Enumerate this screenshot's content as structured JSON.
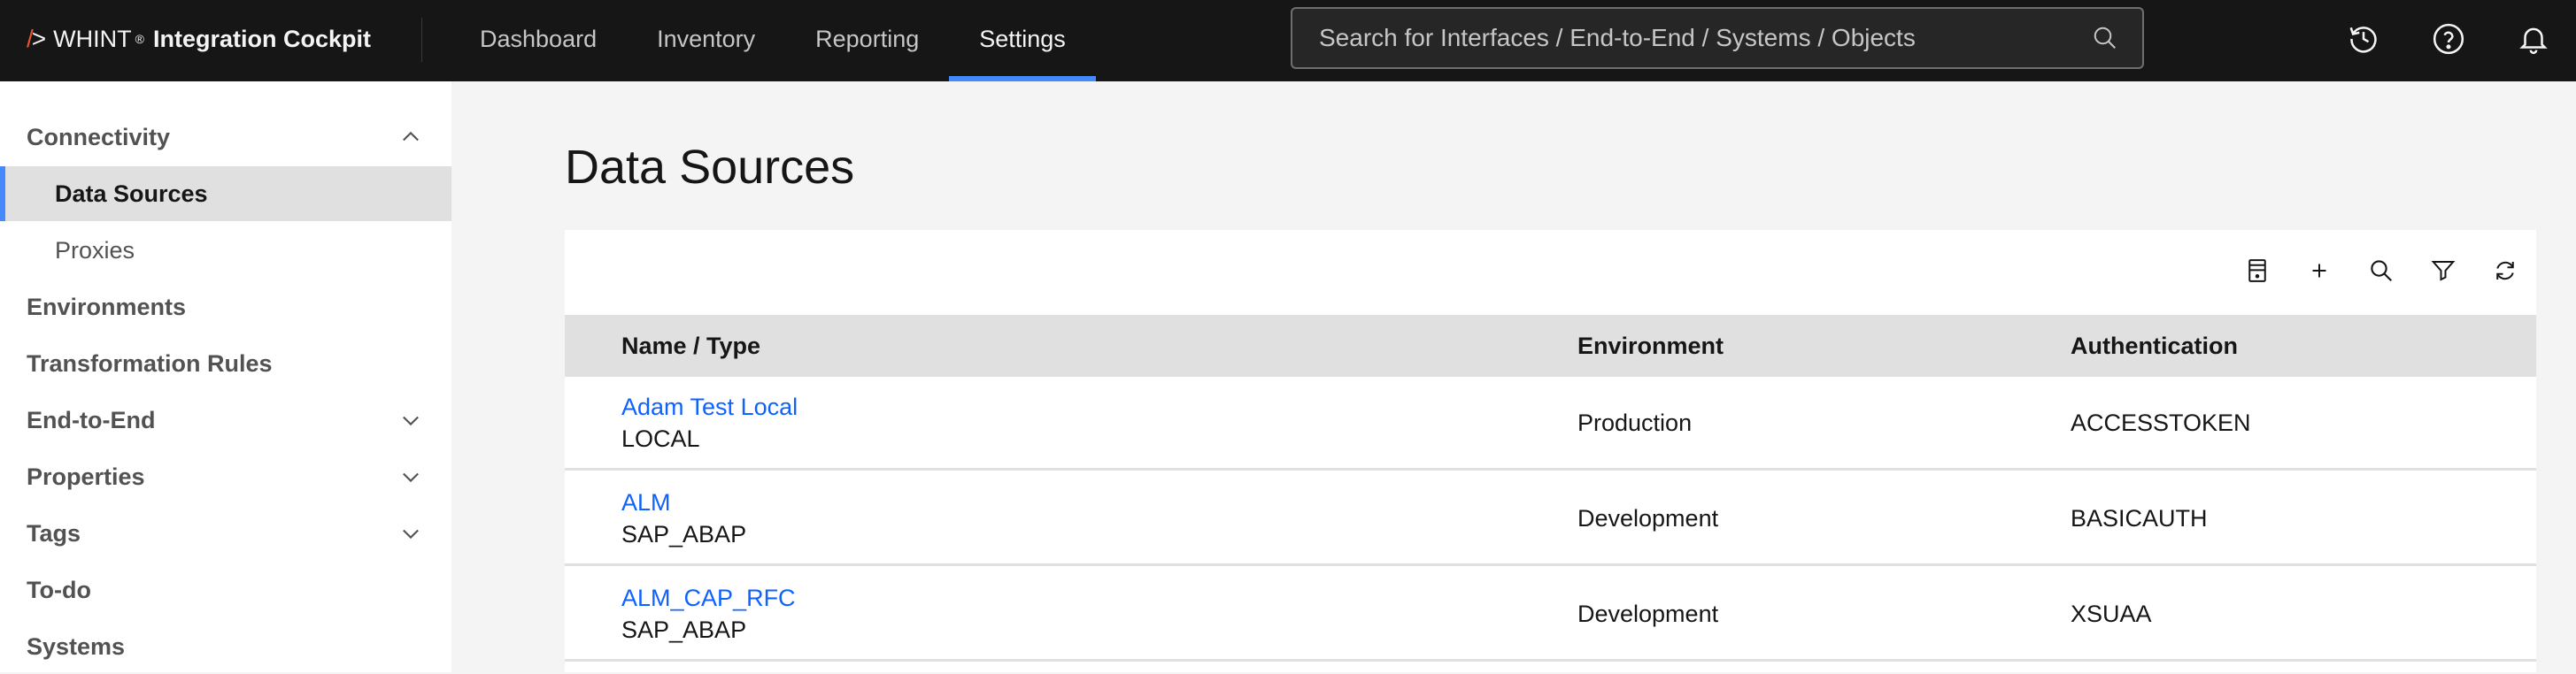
{
  "brand": {
    "mark_slash": "/",
    "mark_gt": ">",
    "name": "WHINT",
    "registered": "®",
    "product": "Integration Cockpit"
  },
  "nav": {
    "items": [
      {
        "label": "Dashboard"
      },
      {
        "label": "Inventory"
      },
      {
        "label": "Reporting"
      },
      {
        "label": "Settings",
        "active": true
      }
    ]
  },
  "search": {
    "placeholder": "Search for Interfaces / End-to-End / Systems / Objects",
    "value": ""
  },
  "top_icons": [
    "history-icon",
    "help-icon",
    "notification-icon"
  ],
  "sidebar": {
    "items": [
      {
        "label": "Connectivity",
        "chevron": "up"
      },
      {
        "label": "Data Sources",
        "sub": true,
        "selected": true
      },
      {
        "label": "Proxies",
        "sub": true
      },
      {
        "label": "Environments"
      },
      {
        "label": "Transformation Rules"
      },
      {
        "label": "End-to-End",
        "chevron": "down"
      },
      {
        "label": "Properties",
        "chevron": "down"
      },
      {
        "label": "Tags",
        "chevron": "down"
      },
      {
        "label": "To-do"
      },
      {
        "label": "Systems"
      }
    ]
  },
  "main": {
    "title": "Data Sources",
    "toolbar": [
      "datasource-icon",
      "add-icon",
      "search-icon",
      "filter-icon",
      "refresh-icon"
    ],
    "table": {
      "columns": [
        "Name / Type",
        "Environment",
        "Authentication"
      ],
      "rows": [
        {
          "name": "Adam Test Local",
          "type": "LOCAL",
          "environment": "Production",
          "authentication": "ACCESSTOKEN"
        },
        {
          "name": "ALM",
          "type": "SAP_ABAP",
          "environment": "Development",
          "authentication": "BASICAUTH"
        },
        {
          "name": "ALM_CAP_RFC",
          "type": "SAP_ABAP",
          "environment": "Development",
          "authentication": "XSUAA"
        }
      ]
    }
  },
  "colors": {
    "topbar": "#161616",
    "accent": "#4589ff",
    "link": "#0f62fe",
    "brand_mark": "#e8542e"
  }
}
